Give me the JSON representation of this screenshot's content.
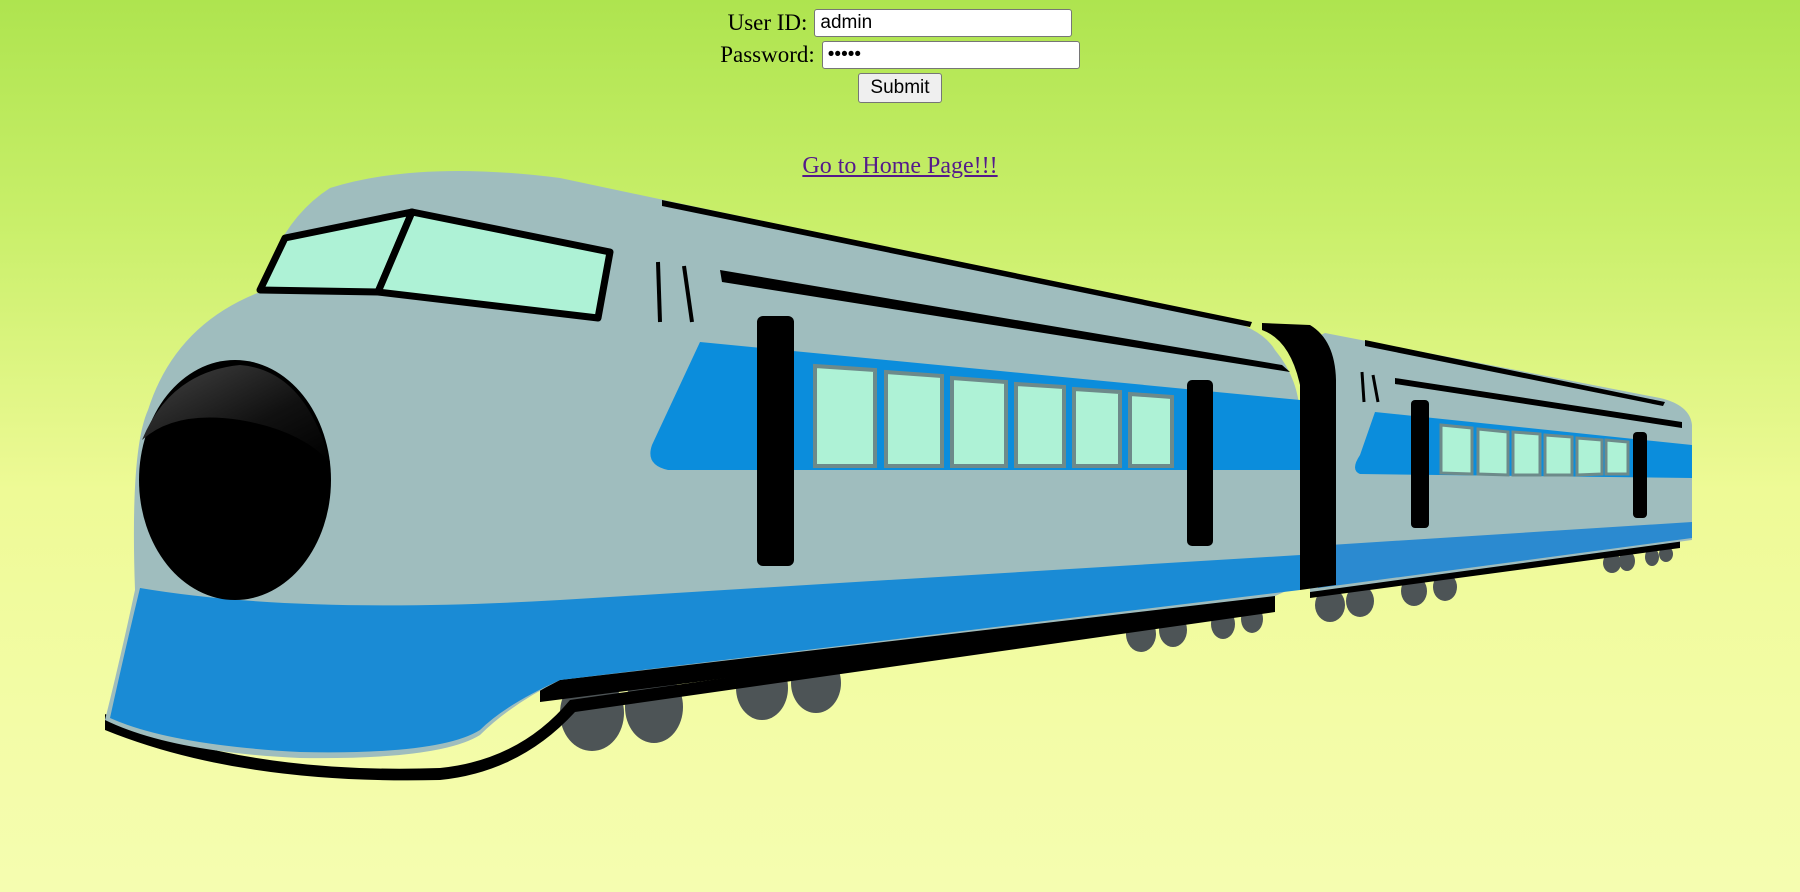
{
  "login": {
    "user_id_label": "User ID:",
    "user_id_value": "admin",
    "password_label": "Password:",
    "password_value": "admin",
    "submit_label": "Submit"
  },
  "home_link": {
    "label": "Go to Home Page!!!"
  },
  "illustration": {
    "icon": "bullet-train-icon",
    "colors": {
      "body": "#9fbdbe",
      "stripe": "#0b8ddc",
      "window": "#aef2d6",
      "outline": "#000000",
      "wheel": "#4d5456"
    }
  }
}
